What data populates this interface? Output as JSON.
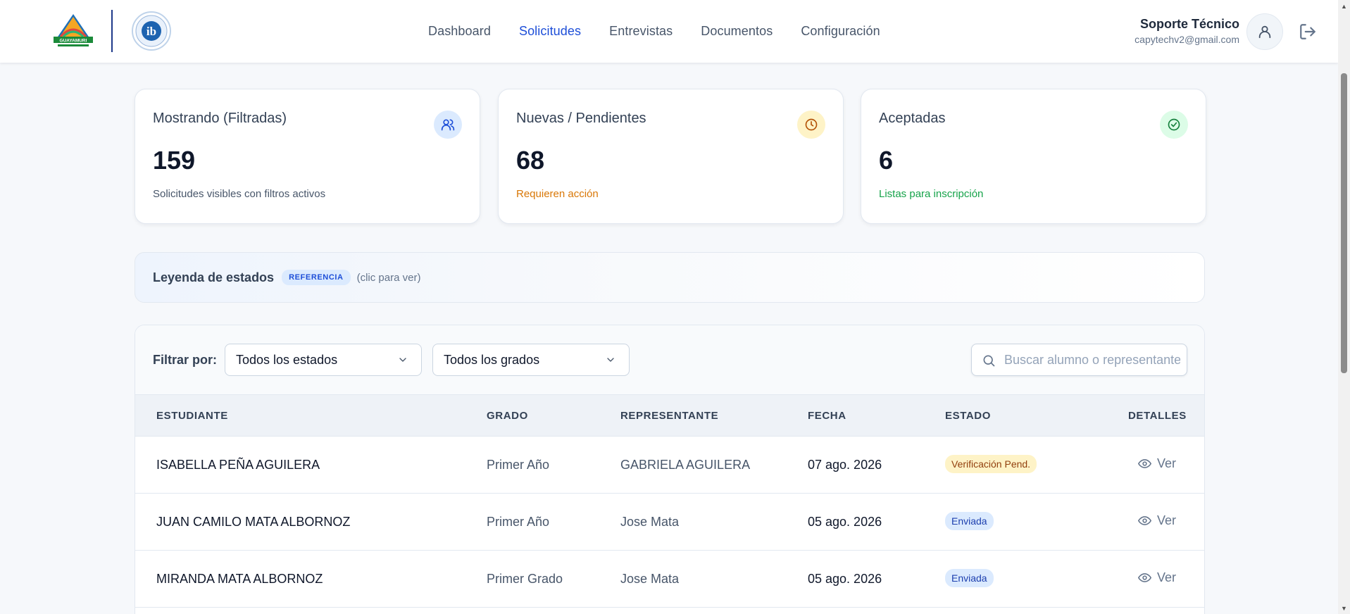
{
  "header": {
    "school_logo_text": "GUAYAMURI",
    "nav": [
      {
        "label": "Dashboard",
        "active": false
      },
      {
        "label": "Solicitudes",
        "active": true
      },
      {
        "label": "Entrevistas",
        "active": false
      },
      {
        "label": "Documentos",
        "active": false
      },
      {
        "label": "Configuración",
        "active": false
      }
    ],
    "user": {
      "name": "Soporte Técnico",
      "email": "capytechv2@gmail.com"
    },
    "icons": {
      "avatar": "user-icon",
      "logout": "logout-icon"
    }
  },
  "stats": [
    {
      "title": "Mostrando (Filtradas)",
      "value": "159",
      "subtitle": "Solicitudes visibles con filtros activos",
      "icon": "users-icon",
      "icon_bg": "#dbeafe",
      "icon_color": "#1d4ed8",
      "subtitle_color": "#475569"
    },
    {
      "title": "Nuevas / Pendientes",
      "value": "68",
      "subtitle": "Requieren acción",
      "icon": "clock-icon",
      "icon_bg": "#fef3c7",
      "icon_color": "#b45309",
      "subtitle_color": "#d97706"
    },
    {
      "title": "Aceptadas",
      "value": "6",
      "subtitle": "Listas para inscripción",
      "icon": "check-circle-icon",
      "icon_bg": "#dcfce7",
      "icon_color": "#15803d",
      "subtitle_color": "#16a34a"
    }
  ],
  "legend": {
    "title": "Leyenda de estados",
    "badge": "REFERENCIA",
    "hint": "(clic para ver)"
  },
  "filters": {
    "label": "Filtrar por:",
    "status_select": "Todos los estados",
    "grade_select": "Todos los grados",
    "search_placeholder": "Buscar alumno o representante"
  },
  "table": {
    "columns": [
      "ESTUDIANTE",
      "GRADO",
      "REPRESENTANTE",
      "FECHA",
      "ESTADO",
      "DETALLES"
    ],
    "rows": [
      {
        "student": "ISABELLA PEÑA AGUILERA",
        "grade": "Primer Año",
        "rep": "GABRIELA AGUILERA",
        "date": "07 ago. 2026",
        "status": "Verificación Pend.",
        "status_type": "pending",
        "action": "Ver"
      },
      {
        "student": "JUAN CAMILO MATA ALBORNOZ",
        "grade": "Primer Año",
        "rep": "Jose Mata",
        "date": "05 ago. 2026",
        "status": "Enviada",
        "status_type": "sent",
        "action": "Ver"
      },
      {
        "student": "MIRANDA MATA ALBORNOZ",
        "grade": "Primer Grado",
        "rep": "Jose Mata",
        "date": "05 ago. 2026",
        "status": "Enviada",
        "status_type": "sent",
        "action": "Ver"
      }
    ]
  },
  "colors": {
    "accent": "#1d4ed8",
    "pending": "#fef3c7",
    "sent": "#dbeafe"
  }
}
